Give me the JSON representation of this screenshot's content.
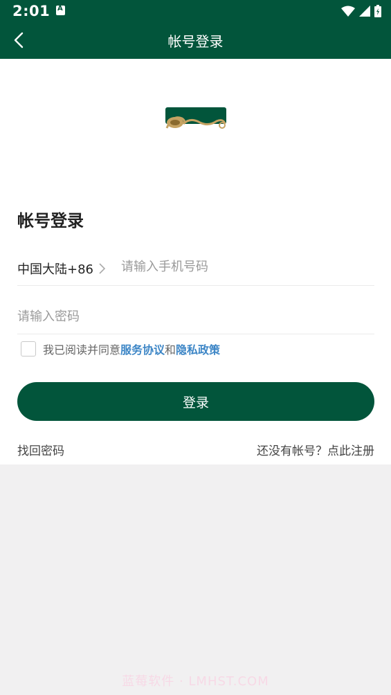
{
  "status_bar": {
    "time": "2:01",
    "icons": [
      "notification-a-icon",
      "wifi-icon",
      "signal-icon",
      "battery-icon"
    ]
  },
  "navbar": {
    "title": "帐号登录",
    "back_icon": "chevron-left-icon"
  },
  "main": {
    "logo": "brand-logo",
    "heading": "帐号登录",
    "country_code": "中国大陆+86",
    "phone_placeholder": "请输入手机号码",
    "phone_value": "",
    "password_placeholder": "请输入密码",
    "password_value": "",
    "agree_prefix": "我已阅读并同意",
    "service_link": "服务协议",
    "agree_and": "和",
    "privacy_link": "隐私政策",
    "login_button": "登录",
    "forgot_password": "找回密码",
    "register": "还没有帐号？点此注册"
  },
  "watermark": "蓝莓软件 · LMHST.COM",
  "colors": {
    "primary": "#02553b",
    "link": "#3d86c6",
    "background": "#f1f0f1"
  }
}
